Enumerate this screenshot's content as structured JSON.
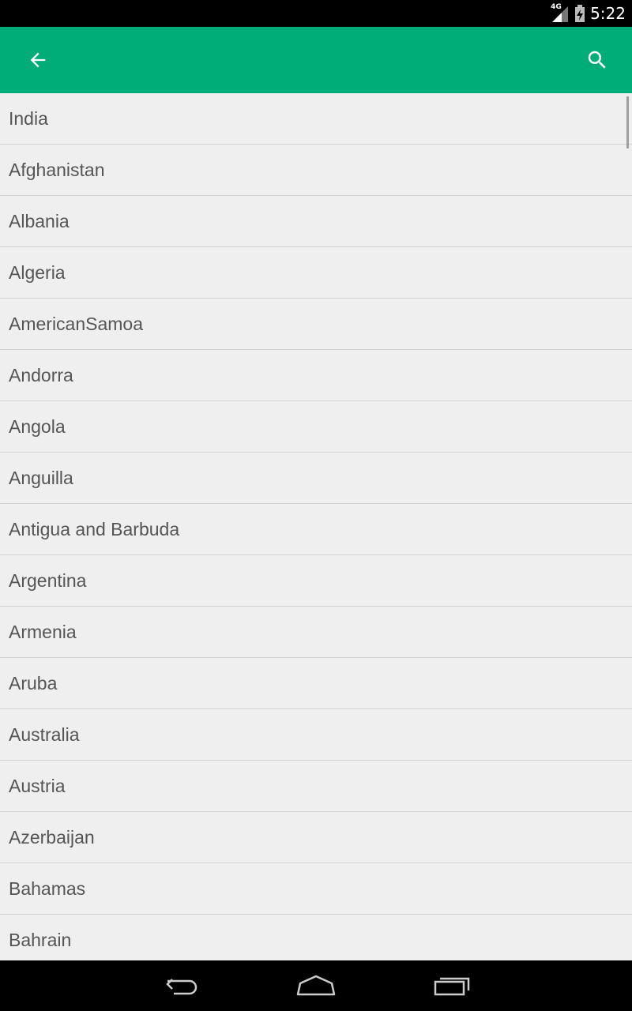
{
  "status_bar": {
    "network_label": "4G",
    "time": "5:22"
  },
  "app_bar": {
    "back_icon": "arrow-left-icon",
    "search_icon": "search-icon",
    "accent_color": "#00ad78"
  },
  "countries": [
    "India",
    "Afghanistan",
    "Albania",
    "Algeria",
    "AmericanSamoa",
    "Andorra",
    "Angola",
    "Anguilla",
    "Antigua and Barbuda",
    "Argentina",
    "Armenia",
    "Aruba",
    "Australia",
    "Austria",
    "Azerbaijan",
    "Bahamas",
    "Bahrain"
  ],
  "nav_bar": {
    "back_icon": "nav-back-icon",
    "home_icon": "nav-home-icon",
    "recents_icon": "nav-recents-icon"
  }
}
